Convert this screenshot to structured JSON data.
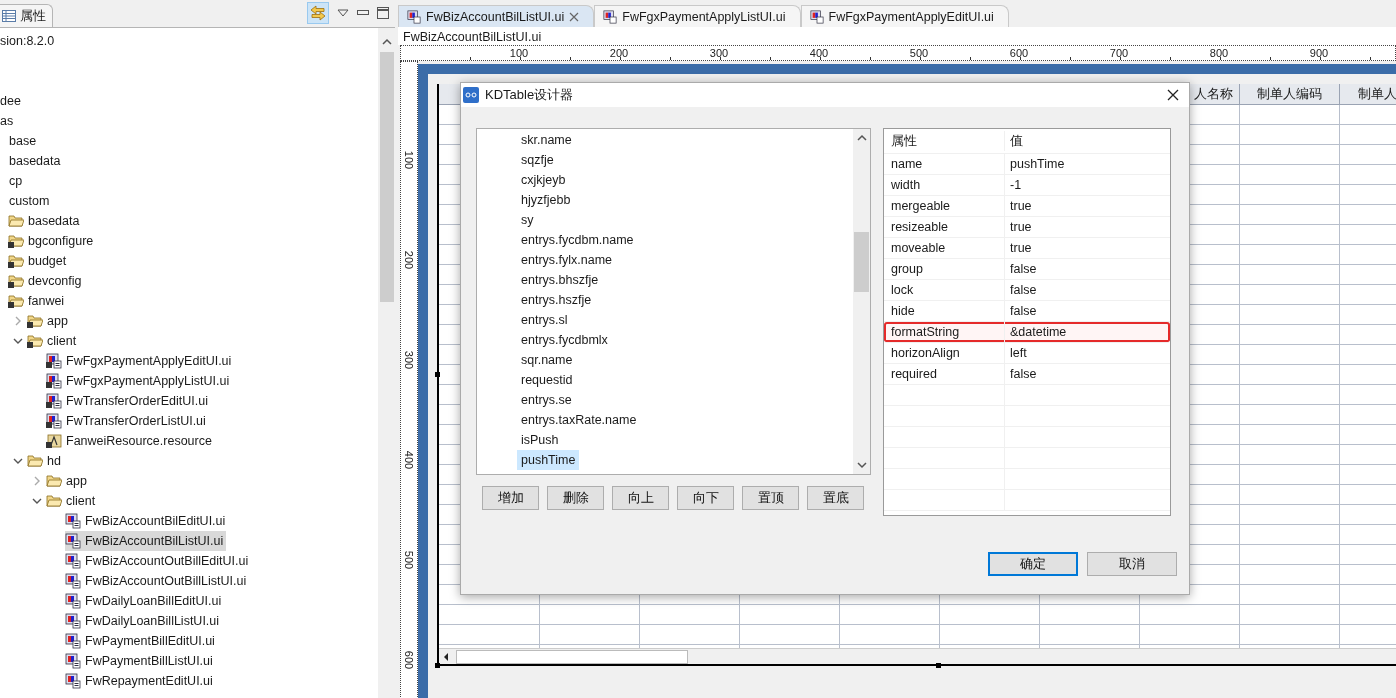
{
  "sidebar": {
    "tab": {
      "label": "属性"
    },
    "tree": [
      {
        "label": "sion:8.2.0",
        "kind": "plain"
      },
      {
        "label": "dee",
        "kind": "plain"
      },
      {
        "label": "as",
        "kind": "plain",
        "children": [
          {
            "label": "base",
            "kind": "plain"
          },
          {
            "label": "basedata",
            "kind": "plain"
          },
          {
            "label": "cp",
            "kind": "plain"
          },
          {
            "label": "custom",
            "kind": "plain",
            "children": [
              {
                "label": "basedata",
                "kind": "folder"
              },
              {
                "label": "bgconfigure",
                "kind": "package"
              },
              {
                "label": "budget",
                "kind": "package"
              },
              {
                "label": "devconfig",
                "kind": "package"
              },
              {
                "label": "fanwei",
                "kind": "package",
                "children": [
                  {
                    "label": "app",
                    "kind": "package",
                    "expanded": false
                  },
                  {
                    "label": "client",
                    "kind": "package",
                    "expanded": true,
                    "children": [
                      {
                        "label": "FwFgxPaymentApplyEditUI.ui",
                        "kind": "package-ui",
                        "selected": false
                      },
                      {
                        "label": "FwFgxPaymentApplyListUI.ui",
                        "kind": "package-ui",
                        "selected": false
                      },
                      {
                        "label": "FwTransferOrderEditUI.ui",
                        "kind": "package-ui",
                        "selected": false
                      },
                      {
                        "label": "FwTransferOrderListUI.ui",
                        "kind": "package-ui",
                        "selected": false
                      },
                      {
                        "label": "FanweiResource.resource",
                        "kind": "resource",
                        "selected": false
                      }
                    ]
                  },
                  {
                    "label": "hd",
                    "kind": "folder",
                    "expanded": true,
                    "children": [
                      {
                        "label": "app",
                        "kind": "folder",
                        "expanded": false
                      },
                      {
                        "label": "client",
                        "kind": "folder",
                        "expanded": true,
                        "children": [
                          {
                            "label": "FwBizAccountBilEditUI.ui",
                            "kind": "ui",
                            "selected": false
                          },
                          {
                            "label": "FwBizAccountBilListUI.ui",
                            "kind": "ui",
                            "selected": true
                          },
                          {
                            "label": "FwBizAccountOutBillEditUI.ui",
                            "kind": "ui",
                            "selected": false
                          },
                          {
                            "label": "FwBizAccountOutBillListUI.ui",
                            "kind": "ui",
                            "selected": false
                          },
                          {
                            "label": "FwDailyLoanBillEditUI.ui",
                            "kind": "ui",
                            "selected": false
                          },
                          {
                            "label": "FwDailyLoanBillListUI.ui",
                            "kind": "ui",
                            "selected": false
                          },
                          {
                            "label": "FwPaymentBillEditUI.ui",
                            "kind": "ui",
                            "selected": false
                          },
                          {
                            "label": "FwPaymentBillListUI.ui",
                            "kind": "ui",
                            "selected": false
                          },
                          {
                            "label": "FwRepaymentEditUI.ui",
                            "kind": "ui",
                            "selected": false
                          }
                        ]
                      }
                    ]
                  }
                ]
              }
            ]
          }
        ]
      }
    ]
  },
  "editor": {
    "tabs": [
      {
        "label": "FwBizAccountBilListUI.ui",
        "selected": true
      },
      {
        "label": "FwFgxPaymentApplyListUI.ui",
        "selected": false
      },
      {
        "label": "FwFgxPaymentApplyEditUI.ui",
        "selected": false
      }
    ],
    "file_title": "FwBizAccountBilListUI.ui",
    "ruler": {
      "x_labels": [
        "100",
        "200",
        "300",
        "400",
        "500",
        "600",
        "700",
        "800",
        "900"
      ],
      "y_labels": [
        "100",
        "200",
        "300",
        "400",
        "500",
        "600"
      ]
    },
    "table_header": [
      "人名称",
      "制单人编码",
      "制单人"
    ]
  },
  "dialog": {
    "title": "KDTable设计器",
    "columns": [
      {
        "label": "skr.name",
        "selected": false
      },
      {
        "label": "sqzfje",
        "selected": false
      },
      {
        "label": "cxjkjeyb",
        "selected": false
      },
      {
        "label": "hjyzfjebb",
        "selected": false
      },
      {
        "label": "sy",
        "selected": false
      },
      {
        "label": "entrys.fycdbm.name",
        "selected": false
      },
      {
        "label": "entrys.fylx.name",
        "selected": false
      },
      {
        "label": "entrys.bhszfje",
        "selected": false
      },
      {
        "label": "entrys.hszfje",
        "selected": false
      },
      {
        "label": "entrys.sl",
        "selected": false
      },
      {
        "label": "entrys.fycdbmlx",
        "selected": false
      },
      {
        "label": "sqr.name",
        "selected": false
      },
      {
        "label": "requestid",
        "selected": false
      },
      {
        "label": "entrys.se",
        "selected": false
      },
      {
        "label": "entrys.taxRate.name",
        "selected": false
      },
      {
        "label": "isPush",
        "selected": false
      },
      {
        "label": "pushTime",
        "selected": true
      }
    ],
    "list_buttons": [
      "增加",
      "删除",
      "向上",
      "向下",
      "置顶",
      "置底"
    ],
    "property_headers": [
      "属性",
      "值"
    ],
    "properties": [
      {
        "name": "name",
        "value": "pushTime",
        "highlighted": false
      },
      {
        "name": "width",
        "value": "-1",
        "highlighted": false
      },
      {
        "name": "mergeable",
        "value": "true",
        "highlighted": false
      },
      {
        "name": "resizeable",
        "value": "true",
        "highlighted": false
      },
      {
        "name": "moveable",
        "value": "true",
        "highlighted": false
      },
      {
        "name": "group",
        "value": "false",
        "highlighted": false
      },
      {
        "name": "lock",
        "value": "false",
        "highlighted": false
      },
      {
        "name": "hide",
        "value": "false",
        "highlighted": false
      },
      {
        "name": "formatString",
        "value": "&datetime",
        "highlighted": true
      },
      {
        "name": "horizonAlign",
        "value": "left",
        "highlighted": false
      },
      {
        "name": "required",
        "value": "false",
        "highlighted": false
      }
    ],
    "ok_button": "确定",
    "cancel_button": "取消"
  }
}
